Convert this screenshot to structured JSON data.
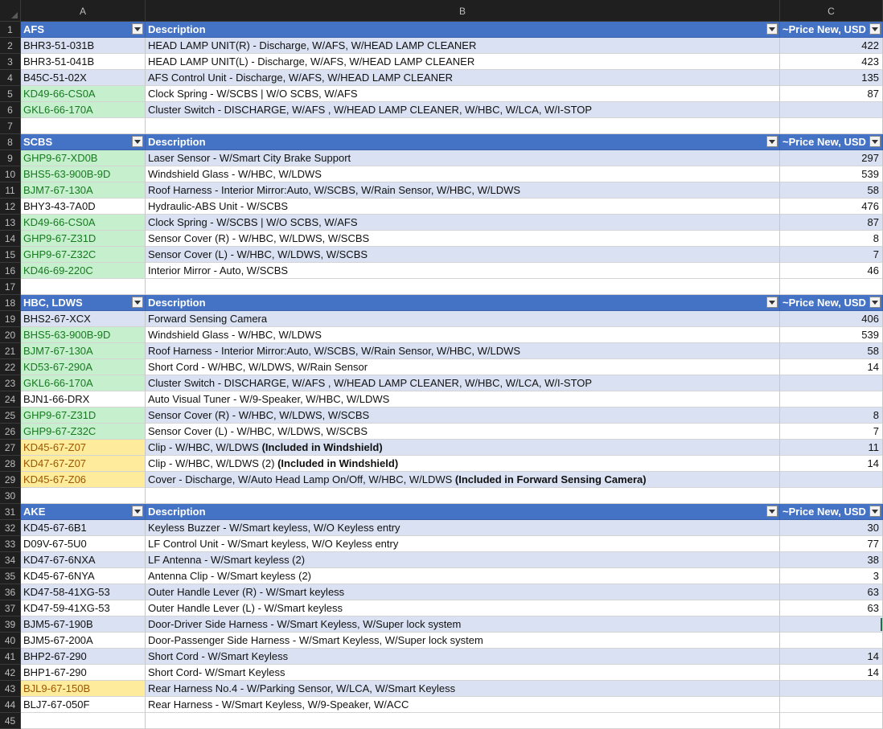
{
  "columns": [
    "A",
    "B",
    "C"
  ],
  "rows": [
    {
      "n": "1",
      "type": "header",
      "a": "AFS",
      "b": "Description",
      "c": "~Price New, USD"
    },
    {
      "n": "2",
      "type": "band",
      "a": "BHR3-51-031B",
      "b": "HEAD LAMP UNIT(R) - Discharge, W/AFS, W/HEAD LAMP CLEANER",
      "c": "422"
    },
    {
      "n": "3",
      "type": "plain",
      "a": "BHR3-51-041B",
      "b": "HEAD LAMP UNIT(L) - Discharge, W/AFS, W/HEAD LAMP CLEANER",
      "c": "423"
    },
    {
      "n": "4",
      "type": "band",
      "a": "B45C-51-02X",
      "b": "AFS Control Unit - Discharge, W/AFS, W/HEAD LAMP CLEANER",
      "c": "135"
    },
    {
      "n": "5",
      "type": "plain",
      "a": "KD49-66-CS0A",
      "a_fmt": "green",
      "b": "Clock Spring - W/SCBS | W/O SCBS, W/AFS",
      "c": "87"
    },
    {
      "n": "6",
      "type": "band",
      "a": "GKL6-66-170A",
      "a_fmt": "green",
      "b": "Cluster Switch - DISCHARGE, W/AFS , W/HEAD LAMP CLEANER, W/HBC, W/LCA, W/I-STOP",
      "c": ""
    },
    {
      "n": "7",
      "type": "blank",
      "a": "",
      "b": "",
      "c": ""
    },
    {
      "n": "8",
      "type": "header",
      "a": "SCBS",
      "b": "Description",
      "c": "~Price New, USD"
    },
    {
      "n": "9",
      "type": "band",
      "a": "GHP9-67-XD0B",
      "a_fmt": "green",
      "b": "Laser Sensor - W/Smart City Brake Support",
      "c": "297"
    },
    {
      "n": "10",
      "type": "plain",
      "a": "BHS5-63-900B-9D",
      "a_fmt": "green",
      "b": "Windshield Glass - W/HBC, W/LDWS",
      "c": "539"
    },
    {
      "n": "11",
      "type": "band",
      "a": "BJM7-67-130A",
      "a_fmt": "green",
      "b": "Roof Harness - Interior Mirror:Auto, W/SCBS, W/Rain Sensor, W/HBC, W/LDWS",
      "c": "58"
    },
    {
      "n": "12",
      "type": "plain",
      "a": "BHY3-43-7A0D",
      "b": "Hydraulic-ABS Unit - W/SCBS",
      "c": "476"
    },
    {
      "n": "13",
      "type": "band",
      "a": "KD49-66-CS0A",
      "a_fmt": "green",
      "b": "Clock Spring - W/SCBS | W/O SCBS, W/AFS",
      "c": "87"
    },
    {
      "n": "14",
      "type": "plain",
      "a": "GHP9-67-Z31D",
      "a_fmt": "green",
      "b": "Sensor Cover (R) - W/HBC, W/LDWS, W/SCBS",
      "c": "8"
    },
    {
      "n": "15",
      "type": "band",
      "a": "GHP9-67-Z32C",
      "a_fmt": "green",
      "b": "Sensor Cover (L) - W/HBC, W/LDWS, W/SCBS",
      "c": "7"
    },
    {
      "n": "16",
      "type": "plain",
      "a": "KD46-69-220C",
      "a_fmt": "green",
      "b": "Interior Mirror - Auto, W/SCBS",
      "c": "46"
    },
    {
      "n": "17",
      "type": "blank",
      "a": "",
      "b": "",
      "c": ""
    },
    {
      "n": "18",
      "type": "header",
      "a": "HBC, LDWS",
      "b": "Description",
      "c": "~Price New, USD"
    },
    {
      "n": "19",
      "type": "band",
      "a": "BHS2-67-XCX",
      "b": "Forward Sensing Camera",
      "c": "406"
    },
    {
      "n": "20",
      "type": "plain",
      "a": "BHS5-63-900B-9D",
      "a_fmt": "green",
      "b": "Windshield Glass - W/HBC, W/LDWS",
      "c": "539"
    },
    {
      "n": "21",
      "type": "band",
      "a": "BJM7-67-130A",
      "a_fmt": "green",
      "b": "Roof Harness - Interior Mirror:Auto, W/SCBS, W/Rain Sensor, W/HBC, W/LDWS",
      "c": "58"
    },
    {
      "n": "22",
      "type": "plain",
      "a": "KD53-67-290A",
      "a_fmt": "green",
      "b": "Short Cord - W/HBC, W/LDWS, W/Rain Sensor",
      "c": "14"
    },
    {
      "n": "23",
      "type": "band",
      "a": "GKL6-66-170A",
      "a_fmt": "green",
      "b": "Cluster Switch - DISCHARGE, W/AFS , W/HEAD LAMP CLEANER, W/HBC, W/LCA, W/I-STOP",
      "c": ""
    },
    {
      "n": "24",
      "type": "plain",
      "a": "BJN1-66-DRX",
      "b": "Auto Visual Tuner - W/9-Speaker, W/HBC, W/LDWS",
      "c": ""
    },
    {
      "n": "25",
      "type": "band",
      "a": "GHP9-67-Z31D",
      "a_fmt": "green",
      "b": "Sensor Cover (R) - W/HBC, W/LDWS, W/SCBS",
      "c": "8"
    },
    {
      "n": "26",
      "type": "plain",
      "a": "GHP9-67-Z32C",
      "a_fmt": "green",
      "b": "Sensor Cover (L) - W/HBC, W/LDWS, W/SCBS",
      "c": "7"
    },
    {
      "n": "27",
      "type": "band",
      "a": "KD45-67-Z07",
      "a_fmt": "yellow",
      "b": "Clip - W/HBC, W/LDWS ",
      "b_bold": "(Included in Windshield)",
      "c": "11"
    },
    {
      "n": "28",
      "type": "plain",
      "a": "KD47-67-Z07",
      "a_fmt": "yellow",
      "b": "Clip - W/HBC, W/LDWS (2) ",
      "b_bold": "(Included in Windshield)",
      "c": "14"
    },
    {
      "n": "29",
      "type": "band",
      "a": "KD45-67-Z06",
      "a_fmt": "yellow",
      "b": "Cover - Discharge, W/Auto Head Lamp On/Off, W/HBC, W/LDWS ",
      "b_bold": "(Included in Forward Sensing Camera)",
      "c": ""
    },
    {
      "n": "30",
      "type": "blank",
      "a": "",
      "b": "",
      "c": ""
    },
    {
      "n": "31",
      "type": "header",
      "a": "AKE",
      "b": "Description",
      "c": "~Price New, USD"
    },
    {
      "n": "32",
      "type": "band",
      "a": "KD45-67-6B1",
      "b": "Keyless Buzzer - W/Smart keyless, W/O Keyless entry",
      "c": "30"
    },
    {
      "n": "33",
      "type": "plain",
      "a": "D09V-67-5U0",
      "b": "LF Control Unit - W/Smart keyless, W/O Keyless entry",
      "c": "77"
    },
    {
      "n": "34",
      "type": "band",
      "a": "KD47-67-6NXA",
      "b": "LF Antenna - W/Smart keyless (2)",
      "c": "38"
    },
    {
      "n": "35",
      "type": "plain",
      "a": "KD45-67-6NYA",
      "b": "Antenna Clip - W/Smart keyless (2)",
      "c": "3"
    },
    {
      "n": "36",
      "type": "band",
      "a": "KD47-58-41XG-53",
      "b": "Outer Handle Lever (R) - W/Smart keyless",
      "c": "63"
    },
    {
      "n": "37",
      "type": "plain",
      "a": "KD47-59-41XG-53",
      "b": "Outer Handle Lever (L) - W/Smart keyless",
      "c": "63"
    },
    {
      "n": "39",
      "type": "band",
      "a": "BJM5-67-190B",
      "b": "Door-Driver Side Harness - W/Smart Keyless, W/Super lock system",
      "c": "",
      "selected": true
    },
    {
      "n": "40",
      "type": "plain",
      "a": "BJM5-67-200A",
      "b": "Door-Passenger Side Harness - W/Smart Keyless, W/Super lock system",
      "c": ""
    },
    {
      "n": "41",
      "type": "band",
      "a": "BHP2-67-290",
      "b": "Short Cord - W/Smart Keyless",
      "c": "14"
    },
    {
      "n": "42",
      "type": "plain",
      "a": "BHP1-67-290",
      "b": "Short Cord- W/Smart Keyless",
      "c": "14"
    },
    {
      "n": "43",
      "type": "band",
      "a": "BJL9-67-150B",
      "a_fmt": "yellow",
      "b": "Rear Harness No.4 - W/Parking Sensor, W/LCA, W/Smart Keyless",
      "c": ""
    },
    {
      "n": "44",
      "type": "plain",
      "a": "BLJ7-67-050F",
      "b": "Rear Harness - W/Smart Keyless, W/9-Speaker, W/ACC",
      "c": ""
    },
    {
      "n": "45",
      "type": "blank",
      "a": "",
      "b": "",
      "c": ""
    }
  ]
}
